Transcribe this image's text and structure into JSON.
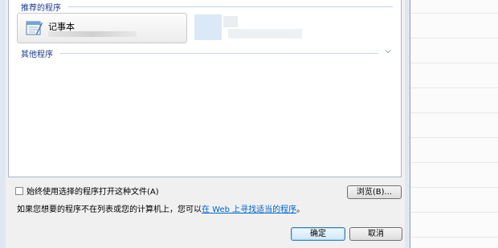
{
  "dialog": {
    "recommended_heading": "推荐的程序",
    "other_heading": "其他程序",
    "recommended_programs": [
      {
        "name": "记事本",
        "icon": "notepad-icon"
      }
    ],
    "always_use_label": "始终使用选择的程序打开这种文件(A)",
    "always_use_checked": false,
    "browse_label": "浏览(B)...",
    "hint_prefix": "如果您想要的程序不在列表或您的计算机上，您可以",
    "hint_link": "在 Web 上寻找适当的程序",
    "hint_suffix": "。",
    "ok_label": "确定",
    "cancel_label": "取消",
    "expand_icon": "chevron-down-icon"
  },
  "colors": {
    "section_text": "#1c3a8b",
    "link": "#0066cc",
    "default_button_border": "#3c7fb1"
  }
}
